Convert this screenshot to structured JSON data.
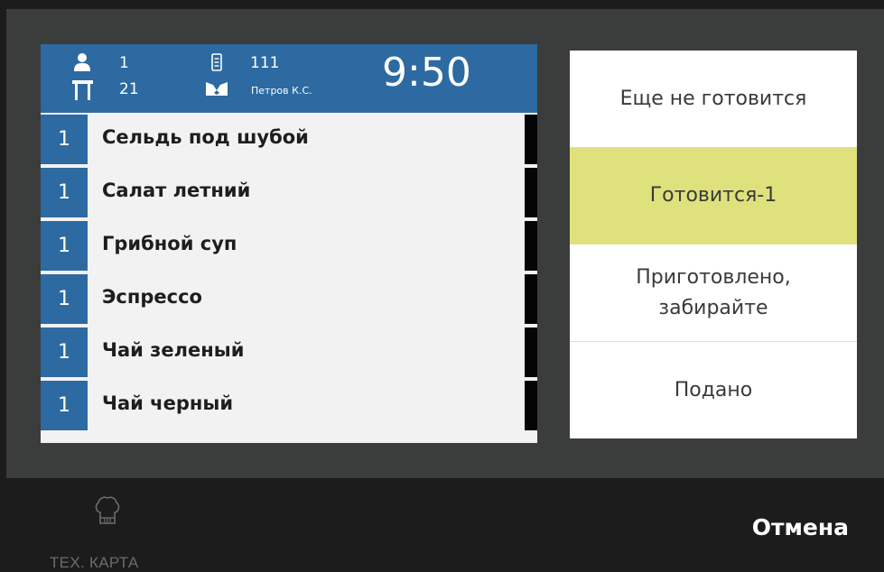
{
  "order": {
    "guests": "1",
    "table": "21",
    "order_number": "111",
    "waiter": "Петров К.С.",
    "time": "9:50",
    "items": [
      {
        "qty": "1",
        "name": "Сельдь под шубой"
      },
      {
        "qty": "1",
        "name": "Салат летний"
      },
      {
        "qty": "1",
        "name": "Грибной суп"
      },
      {
        "qty": "1",
        "name": "Эспрессо"
      },
      {
        "qty": "1",
        "name": "Чай зеленый"
      },
      {
        "qty": "1",
        "name": "Чай черный"
      }
    ]
  },
  "statuses": [
    {
      "label": "Еще не готовится",
      "active": false
    },
    {
      "label": "Готовится-1",
      "active": true
    },
    {
      "label": "Приготовлено, забирайте",
      "active": false
    },
    {
      "label": "Подано",
      "active": false
    }
  ],
  "bottom": {
    "techcard_label": "ТЕХ. КАРТА",
    "techcard_icon": "chef-hat-icon",
    "cancel_label": "Отмена"
  },
  "colors": {
    "header_blue": "#2d6aa1",
    "active_status": "#dfe27c",
    "modal_bg": "#3b3c3c",
    "bottom_bg": "#1c1c1c"
  }
}
